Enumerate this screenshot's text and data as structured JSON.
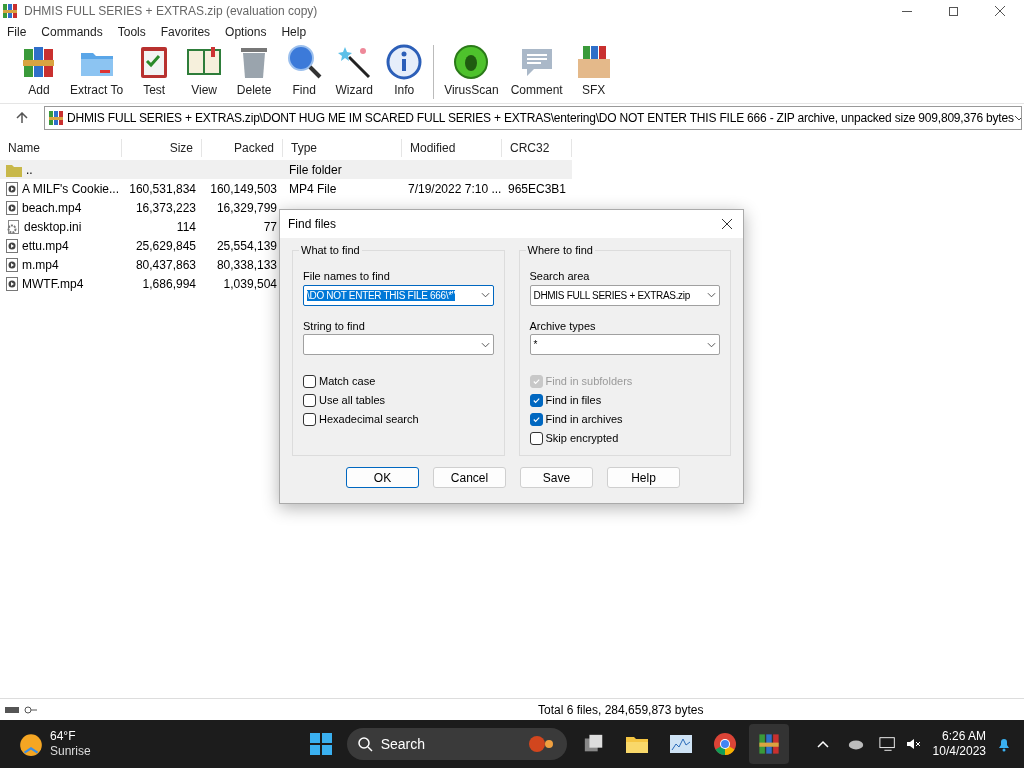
{
  "window": {
    "title": "DHMIS FULL SERIES + EXTRAS.zip (evaluation copy)"
  },
  "menu": [
    "File",
    "Commands",
    "Tools",
    "Favorites",
    "Options",
    "Help"
  ],
  "toolbar": [
    {
      "label": "Add",
      "kind": "add"
    },
    {
      "label": "Extract To",
      "kind": "extract"
    },
    {
      "label": "Test",
      "kind": "test"
    },
    {
      "label": "View",
      "kind": "view"
    },
    {
      "label": "Delete",
      "kind": "delete"
    },
    {
      "label": "Find",
      "kind": "find"
    },
    {
      "label": "Wizard",
      "kind": "wizard"
    },
    {
      "label": "Info",
      "kind": "info"
    },
    {
      "label": "VirusScan",
      "kind": "virus"
    },
    {
      "label": "Comment",
      "kind": "comment"
    },
    {
      "label": "SFX",
      "kind": "sfx"
    }
  ],
  "address": "DHMIS FULL SERIES + EXTRAS.zip\\DONT HUG ME IM SCARED FULL SERIES + EXTRAS\\entering\\DO NOT ENTER THIS FILE 666 - ZIP archive, unpacked size 909,809,376 bytes",
  "table": {
    "columns": [
      "Name",
      "Size",
      "Packed",
      "Type",
      "Modified",
      "CRC32"
    ],
    "rows": [
      {
        "kind": "folder",
        "name": "..",
        "type": "File folder",
        "selected": true
      },
      {
        "kind": "video",
        "name": "A MILF's Cookie...",
        "size": "160,531,834",
        "packed": "160,149,503",
        "type": "MP4 File",
        "modified": "7/19/2022 7:10 ...",
        "crc": "965EC3B1",
        "selected": false
      },
      {
        "kind": "video",
        "name": "beach.mp4",
        "size": "16,373,223",
        "packed": "16,329,799",
        "selected": false
      },
      {
        "kind": "settings",
        "name": "desktop.ini",
        "size": "114",
        "packed": "77",
        "selected": false
      },
      {
        "kind": "video",
        "name": "ettu.mp4",
        "size": "25,629,845",
        "packed": "25,554,139",
        "selected": false
      },
      {
        "kind": "video",
        "name": "m.mp4",
        "size": "80,437,863",
        "packed": "80,338,133",
        "selected": false
      },
      {
        "kind": "video",
        "name": "MWTF.mp4",
        "size": "1,686,994",
        "packed": "1,039,504",
        "selected": false
      }
    ]
  },
  "dialog": {
    "title": "Find files",
    "what": {
      "legend": "What to find",
      "file_label": "File names to find",
      "file_value": "\\DO NOT ENTER THIS FILE 666\\*\"",
      "string_label": "String to find",
      "options": [
        {
          "label": "Match case",
          "checked": false,
          "disabled": false
        },
        {
          "label": "Use all tables",
          "checked": false,
          "disabled": false
        },
        {
          "label": "Hexadecimal search",
          "checked": false,
          "disabled": false
        }
      ]
    },
    "where": {
      "legend": "Where to find",
      "area_label": "Search area",
      "area_value": "DHMIS FULL SERIES + EXTRAS.zip",
      "types_label": "Archive types",
      "types_value": "*",
      "options": [
        {
          "label": "Find in subfolders",
          "checked": true,
          "disabled": true
        },
        {
          "label": "Find in files",
          "checked": true,
          "disabled": false
        },
        {
          "label": "Find in archives",
          "checked": true,
          "disabled": false
        },
        {
          "label": "Skip encrypted",
          "checked": false,
          "disabled": false
        }
      ]
    },
    "buttons": [
      {
        "label": "OK",
        "selected": true
      },
      {
        "label": "Cancel",
        "selected": false
      },
      {
        "label": "Save",
        "selected": false
      },
      {
        "label": "Help",
        "selected": false
      }
    ]
  },
  "status": "Total 6 files, 284,659,873 bytes",
  "taskbar": {
    "temp": "64°F",
    "weather": "Sunrise",
    "search": "Search",
    "time": "6:26 AM",
    "date": "10/4/2023"
  }
}
